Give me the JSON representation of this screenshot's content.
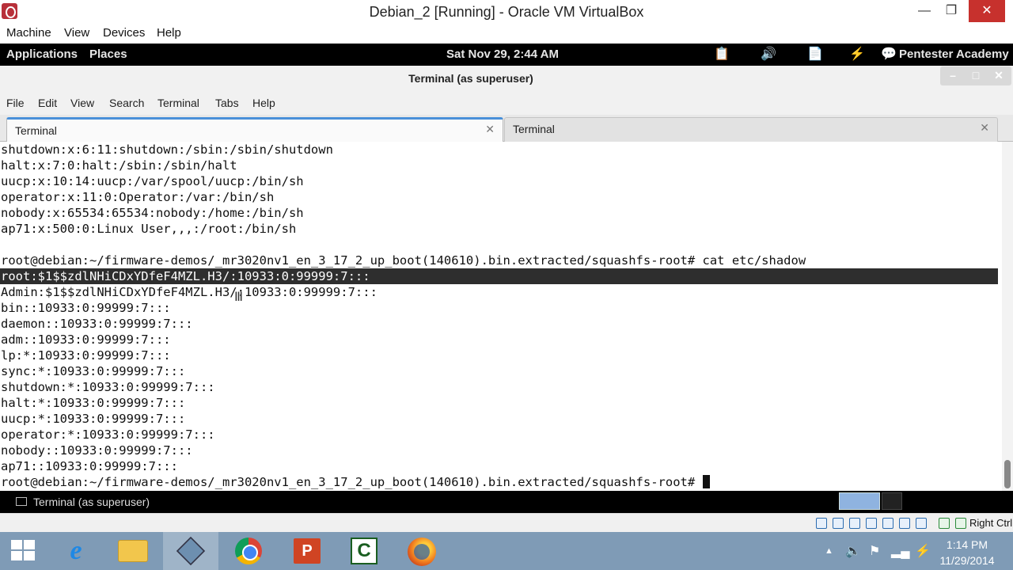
{
  "vbox": {
    "title": "Debian_2 [Running] - Oracle VM VirtualBox",
    "menu": [
      "Machine",
      "View",
      "Devices",
      "Help"
    ],
    "status": {
      "host_key": "Right Ctrl"
    }
  },
  "gnome": {
    "applications": "Applications",
    "places": "Places",
    "datetime": "Sat Nov 29,  2:44 AM",
    "user": "Pentester Academy"
  },
  "terminal": {
    "window_title": "Terminal (as superuser)",
    "menu": [
      "File",
      "Edit",
      "View",
      "Search",
      "Terminal",
      "Tabs",
      "Help"
    ],
    "tabs": [
      {
        "label": "Terminal",
        "close": "✕"
      },
      {
        "label": "Terminal",
        "close": "✕"
      }
    ],
    "lines": [
      "shutdown:x:6:11:shutdown:/sbin:/sbin/shutdown",
      "halt:x:7:0:halt:/sbin:/sbin/halt",
      "uucp:x:10:14:uucp:/var/spool/uucp:/bin/sh",
      "operator:x:11:0:Operator:/var:/bin/sh",
      "nobody:x:65534:65534:nobody:/home:/bin/sh",
      "ap71:x:500:0:Linux User,,,:/root:/bin/sh",
      "",
      "root@debian:~/firmware-demos/_mr3020nv1_en_3_17_2_up_boot(140610).bin.extracted/squashfs-root# cat etc/shadow",
      "root:$1$$zdlNHiCDxYDfeF4MZL.H3/:10933:0:99999:7:::",
      "Admin:$1$$zdlNHiCDxYDfeF4MZL.H3/:10933:0:99999:7:::",
      "bin::10933:0:99999:7:::",
      "daemon::10933:0:99999:7:::",
      "adm::10933:0:99999:7:::",
      "lp:*:10933:0:99999:7:::",
      "sync:*:10933:0:99999:7:::",
      "shutdown:*:10933:0:99999:7:::",
      "halt:*:10933:0:99999:7:::",
      "uucp:*:10933:0:99999:7:::",
      "operator:*:10933:0:99999:7:::",
      "nobody::10933:0:99999:7:::",
      "ap71::10933:0:99999:7:::",
      "root@debian:~/firmware-demos/_mr3020nv1_en_3_17_2_up_boot(140610).bin.extracted/squashfs-root# "
    ],
    "selected_line_index": 8
  },
  "bottom_panel": {
    "task_label": "Terminal (as superuser)"
  },
  "windows": {
    "clock_time": "1:14 PM",
    "clock_date": "11/29/2014"
  },
  "colors": {
    "taskbar": "#7f9bb6",
    "close_red": "#c7312d",
    "tab_accent": "#4a90d9",
    "selection": "#2e2e2e"
  }
}
